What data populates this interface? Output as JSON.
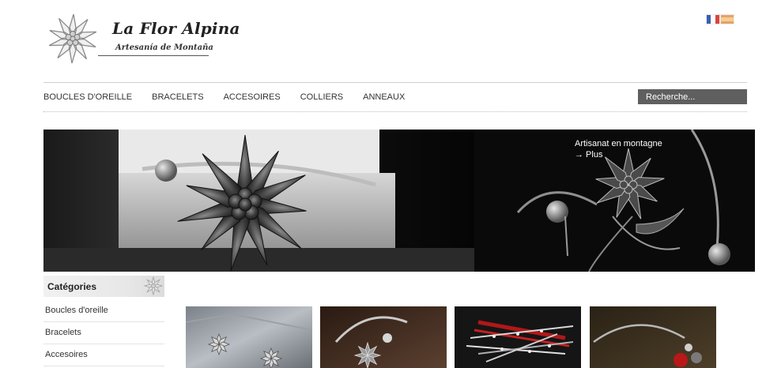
{
  "header": {
    "brand": "La Flor Alpina",
    "tagline": "Artesanía de Montaña",
    "languages": [
      "Français",
      "Español"
    ]
  },
  "nav": {
    "items": [
      "BOUCLES D'OREILLE",
      "BRACELETS",
      "ACCESOIRES",
      "COLLIERS",
      "ANNEAUX"
    ],
    "search_placeholder": "Recherche..."
  },
  "banner": {
    "caption": "Artisanat en montagne",
    "more": "→ Plus"
  },
  "sidebar": {
    "title": "Catégories",
    "items": [
      "Boucles d'oreille",
      "Bracelets",
      "Accesoires"
    ]
  },
  "products": [
    {
      "image": "edelweiss-earrings-on-stone"
    },
    {
      "image": "edelweiss-bangle-bracelet"
    },
    {
      "image": "red-black-beaded-bracelets"
    },
    {
      "image": "bangle-with-red-bead-charm"
    }
  ],
  "colors": {
    "nav_text": "#333333",
    "search_bg": "#5f5f5f",
    "banner_bg": "#0e0e0e"
  }
}
